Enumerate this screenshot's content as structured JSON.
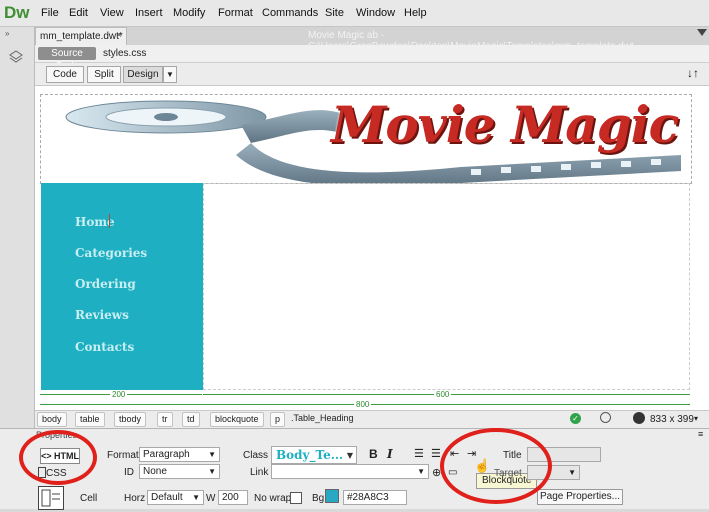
{
  "app": {
    "logo": "Dw"
  },
  "menu": [
    "File",
    "Edit",
    "View",
    "Insert",
    "Modify",
    "Format",
    "Commands",
    "Site",
    "Window",
    "Help"
  ],
  "document": {
    "tab": "mm_template.dwt*",
    "path": "Movie Magic ab - C:\\Users\\GregBowden\\Desktop\\MovieMagic\\Templates\\mm_template.dwt",
    "source_code": "Source Code",
    "related_file": "styles.css"
  },
  "views": {
    "code": "Code",
    "split": "Split",
    "design": "Design"
  },
  "banner": {
    "title": "Movie Magic"
  },
  "nav": [
    "Home",
    "Categories",
    "Ordering",
    "Reviews",
    "Contacts"
  ],
  "guides": {
    "left": "200",
    "right": "600",
    "total": "800"
  },
  "tags": [
    "body",
    "table",
    "tbody",
    "tr",
    "td",
    "blockquote",
    "p",
    ".Table_Heading"
  ],
  "status": {
    "dims": "833 x 399"
  },
  "properties": {
    "title": "Properties",
    "html_btn": "HTML",
    "css_btn": "CSS",
    "format_label": "Format",
    "format_value": "Paragraph",
    "id_label": "ID",
    "id_value": "None",
    "class_label": "Class",
    "class_value": "Body_Te...",
    "link_label": "Link",
    "title_label": "Title",
    "target_label": "Target",
    "tooltip": "Blockquote",
    "cell_label": "Cell",
    "horz_label": "Horz",
    "horz_value": "Default",
    "w_label": "W",
    "w_value": "200",
    "nowrap_label": "No wrap",
    "bg_label": "Bg",
    "bg_value": "#28A8C3",
    "page_properties": "Page Properties..."
  },
  "colors": {
    "sidebar": "#1eb0c2",
    "annotation": "#e0201a"
  }
}
